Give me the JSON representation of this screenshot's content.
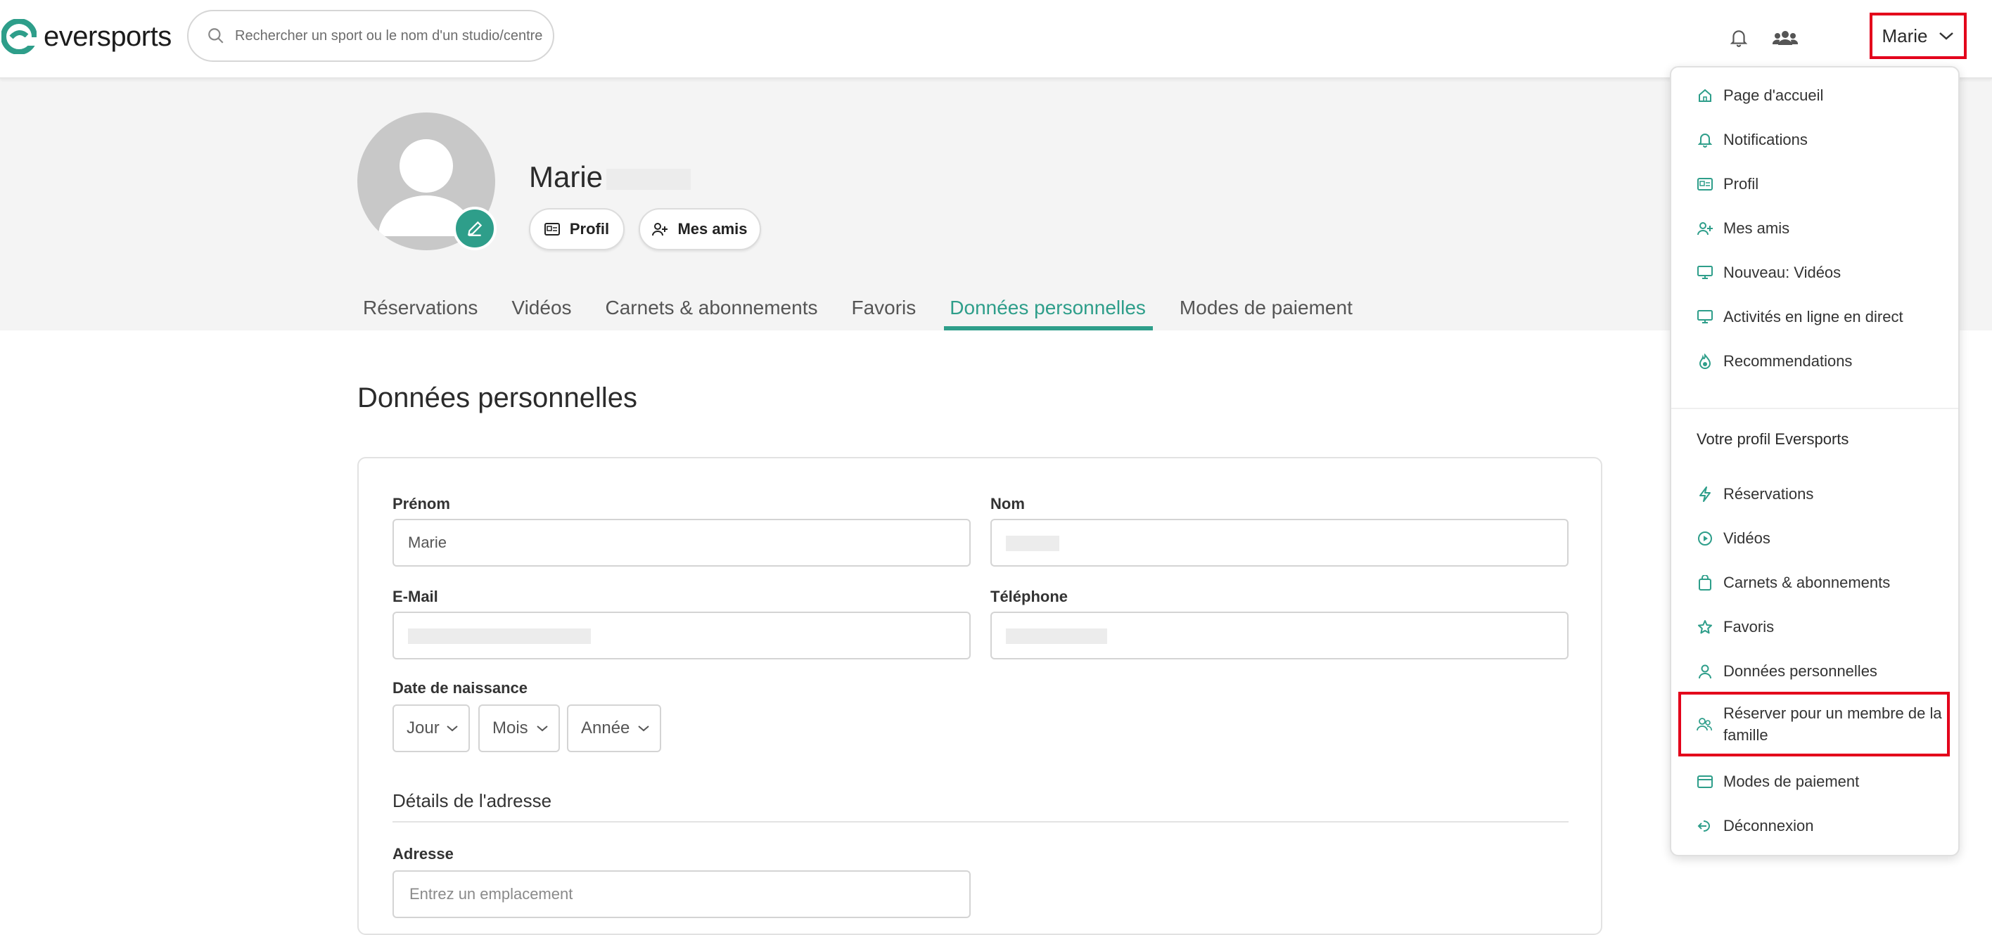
{
  "brand": {
    "name": "eversports",
    "accent": "#2e9e8a",
    "highlight": "#e3001b"
  },
  "search": {
    "placeholder": "Rechercher un sport ou le nom d'un studio/centre sportif"
  },
  "header": {
    "user_label": "Marie"
  },
  "profile": {
    "name": "Marie",
    "buttons": {
      "profile": "Profil",
      "friends": "Mes amis"
    },
    "tabs": [
      "Réservations",
      "Vidéos",
      "Carnets & abonnements",
      "Favoris",
      "Données personnelles",
      "Modes de paiement"
    ],
    "active_tab": "Données personnelles"
  },
  "form": {
    "title": "Données personnelles",
    "first_name": {
      "label": "Prénom",
      "value": "Marie"
    },
    "last_name": {
      "label": "Nom"
    },
    "email": {
      "label": "E-Mail"
    },
    "phone": {
      "label": "Téléphone"
    },
    "birth": {
      "label": "Date de naissance",
      "day": "Jour",
      "month": "Mois",
      "year": "Année"
    },
    "address_section": "Détails de l'adresse",
    "address": {
      "label": "Adresse",
      "placeholder": "Entrez un emplacement"
    }
  },
  "menu": {
    "items": [
      {
        "label": "Page d'accueil",
        "icon": "home-icon"
      },
      {
        "label": "Notifications",
        "icon": "bell-icon"
      },
      {
        "label": "Profil",
        "icon": "id-card-icon"
      },
      {
        "label": "Mes amis",
        "icon": "add-friend-icon"
      },
      {
        "label": "Nouveau: Vidéos",
        "icon": "monitor-icon"
      },
      {
        "label": "Activités en ligne en direct",
        "icon": "monitor-icon"
      },
      {
        "label": "Recommendations",
        "icon": "flame-icon"
      }
    ],
    "section_title": "Votre profil Eversports",
    "profile_items": [
      {
        "label": "Réservations",
        "icon": "bolt-icon"
      },
      {
        "label": "Vidéos",
        "icon": "play-icon"
      },
      {
        "label": "Carnets & abonnements",
        "icon": "bag-icon"
      },
      {
        "label": "Favoris",
        "icon": "star-icon"
      },
      {
        "label": "Données personnelles",
        "icon": "person-icon"
      },
      {
        "label": "Réserver pour un membre de la famille",
        "icon": "family-icon"
      },
      {
        "label": "Modes de paiement",
        "icon": "card-icon"
      },
      {
        "label": "Déconnexion",
        "icon": "logout-icon"
      }
    ]
  }
}
